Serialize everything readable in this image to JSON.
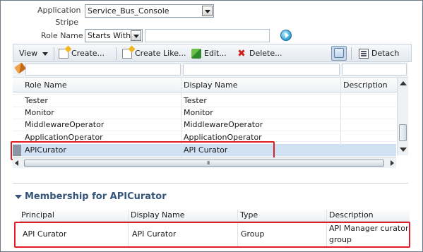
{
  "search": {
    "stripe_label": "Application Stripe",
    "stripe_label_line1": "Application",
    "stripe_label_line2": "Stripe",
    "stripe_value": "Service_Bus_Console",
    "role_name_label": "Role Name",
    "operator_value": "Starts With",
    "role_name_value": ""
  },
  "toolbar": {
    "view_label": "View",
    "create_label": "Create...",
    "create_like_label": "Create Like...",
    "edit_label": "Edit...",
    "delete_label": "Delete...",
    "detach_label": "Detach"
  },
  "roles_table": {
    "columns": [
      "Role Name",
      "Display Name",
      "Description"
    ],
    "rows": [
      {
        "role_name": "Tester",
        "display_name": "Tester",
        "description": ""
      },
      {
        "role_name": "Monitor",
        "display_name": "Monitor",
        "description": ""
      },
      {
        "role_name": "MiddlewareOperator",
        "display_name": "MiddlewareOperator",
        "description": ""
      },
      {
        "role_name": "ApplicationOperator",
        "display_name": "ApplicationOperator",
        "description": ""
      },
      {
        "role_name": "APICurator",
        "display_name": "API Curator",
        "description": ""
      }
    ],
    "selected_row": "APICurator",
    "hscroll_grip": "III"
  },
  "membership": {
    "title": "Membership for APICurator",
    "columns": [
      "Principal",
      "Display Name",
      "Type",
      "Description"
    ],
    "rows": [
      {
        "principal": "API Curator",
        "display_name": "API Curator",
        "type": "Group",
        "description_line1": "API Manager curator",
        "description_line2": "group"
      }
    ]
  },
  "colors": {
    "highlight": "#e11c24",
    "panel_title": "#35557a",
    "selected_row": "#cfe1f3"
  }
}
